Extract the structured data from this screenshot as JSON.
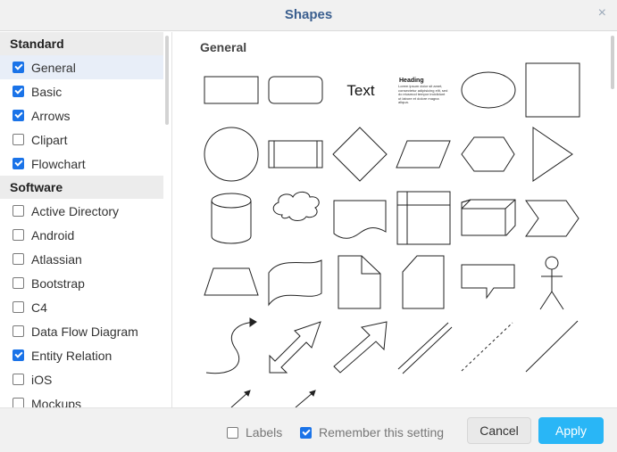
{
  "dialog": {
    "title": "Shapes",
    "close_symbol": "×"
  },
  "sidebar": {
    "sections": [
      {
        "label": "Standard",
        "items": [
          {
            "label": "General",
            "checked": true,
            "active": true
          },
          {
            "label": "Basic",
            "checked": true
          },
          {
            "label": "Arrows",
            "checked": true
          },
          {
            "label": "Clipart",
            "checked": false
          },
          {
            "label": "Flowchart",
            "checked": true
          }
        ]
      },
      {
        "label": "Software",
        "items": [
          {
            "label": "Active Directory",
            "checked": false
          },
          {
            "label": "Android",
            "checked": false
          },
          {
            "label": "Atlassian",
            "checked": false
          },
          {
            "label": "Bootstrap",
            "checked": false
          },
          {
            "label": "C4",
            "checked": false
          },
          {
            "label": "Data Flow Diagram",
            "checked": false
          },
          {
            "label": "Entity Relation",
            "checked": true
          },
          {
            "label": "iOS",
            "checked": false
          },
          {
            "label": "Mockups",
            "checked": false
          }
        ]
      }
    ]
  },
  "main": {
    "category": "General",
    "text_shape_label": "Text",
    "heading_shape": {
      "heading": "Heading",
      "body": "Lorem ipsum dolor sit amet, consectetur adipisicing elit, sed do eiusmod tempor incididunt ut labore et dolore magna aliqua."
    },
    "shape_icons": [
      "rectangle-icon",
      "rounded-rectangle-icon",
      "text-icon",
      "textbox-icon",
      "ellipse-icon",
      "square-icon",
      "circle-icon",
      "process-icon",
      "diamond-icon",
      "parallelogram-icon",
      "hexagon-icon",
      "triangle-icon",
      "cylinder-icon",
      "cloud-icon",
      "document-icon",
      "internal-storage-icon",
      "cube-icon",
      "step-icon",
      "trapezoid-icon",
      "tape-icon",
      "note-icon",
      "card-icon",
      "callout-icon",
      "actor-icon",
      "curved-arrow-icon",
      "bidirectional-arrow-icon",
      "single-arrow-icon",
      "link-icon",
      "dashed-line-icon",
      "line-icon",
      "arrow-icon",
      "arrow-icon"
    ]
  },
  "footer": {
    "labels_checkbox": {
      "label": "Labels",
      "checked": false
    },
    "remember_checkbox": {
      "label": "Remember this setting",
      "checked": true
    },
    "cancel_label": "Cancel",
    "apply_label": "Apply"
  }
}
